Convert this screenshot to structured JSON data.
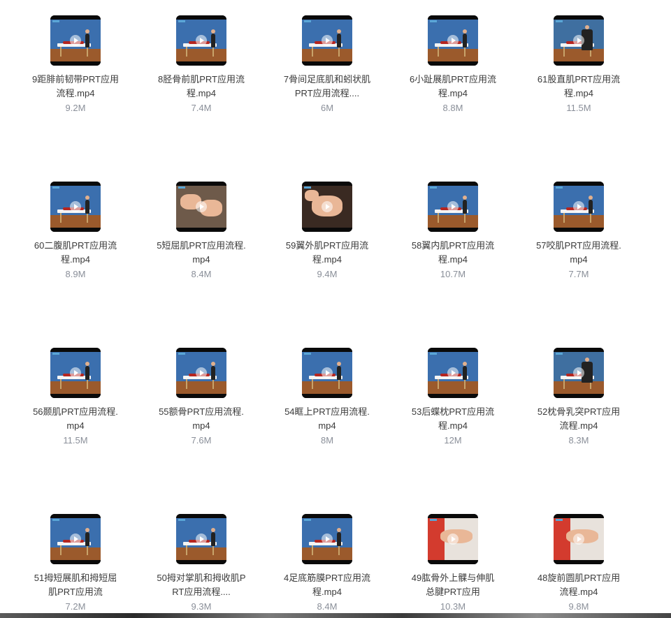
{
  "files": [
    {
      "name": "9距腓前韧带PRT应用流程.mp4",
      "size": "9.2M",
      "thumb": "room"
    },
    {
      "name": "8胫骨前肌PRT应用流程.mp4",
      "size": "7.4M",
      "thumb": "room"
    },
    {
      "name": "7骨间足底肌和蚓状肌PRT应用流程....",
      "size": "6M",
      "thumb": "room"
    },
    {
      "name": "6小趾展肌PRT应用流程.mp4",
      "size": "8.8M",
      "thumb": "room"
    },
    {
      "name": "61股直肌PRT应用流程.mp4",
      "size": "11.5M",
      "thumb": "blue"
    },
    {
      "name": "60二腹肌PRT应用流程.mp4",
      "size": "8.9M",
      "thumb": "room"
    },
    {
      "name": "5短屈肌PRT应用流程.mp4",
      "size": "8.4M",
      "thumb": "closeup"
    },
    {
      "name": "59翼外肌PRT应用流程.mp4",
      "size": "9.4M",
      "thumb": "face"
    },
    {
      "name": "58翼内肌PRT应用流程.mp4",
      "size": "10.7M",
      "thumb": "room"
    },
    {
      "name": "57咬肌PRT应用流程.mp4",
      "size": "7.7M",
      "thumb": "room"
    },
    {
      "name": "56颞肌PRT应用流程.mp4",
      "size": "11.5M",
      "thumb": "room"
    },
    {
      "name": "55额骨PRT应用流程.mp4",
      "size": "7.6M",
      "thumb": "room"
    },
    {
      "name": "54眶上PRT应用流程.mp4",
      "size": "8M",
      "thumb": "room"
    },
    {
      "name": "53后蝶枕PRT应用流程.mp4",
      "size": "12M",
      "thumb": "room"
    },
    {
      "name": "52枕骨乳突PRT应用流程.mp4",
      "size": "8.3M",
      "thumb": "blue"
    },
    {
      "name": "51拇短展肌和拇短屈肌PRT应用流",
      "size": "7.2M",
      "thumb": "room"
    },
    {
      "name": "50拇对掌肌和拇收肌PRT应用流程....",
      "size": "9.3M",
      "thumb": "room"
    },
    {
      "name": "4足底筋膜PRT应用流程.mp4",
      "size": "8.4M",
      "thumb": "room"
    },
    {
      "name": "49肱骨外上髁与伸肌总腱PRT应用",
      "size": "10.3M",
      "thumb": "arm"
    },
    {
      "name": "48旋前圆肌PRT应用流程.mp4",
      "size": "9.8M",
      "thumb": "arm"
    }
  ]
}
